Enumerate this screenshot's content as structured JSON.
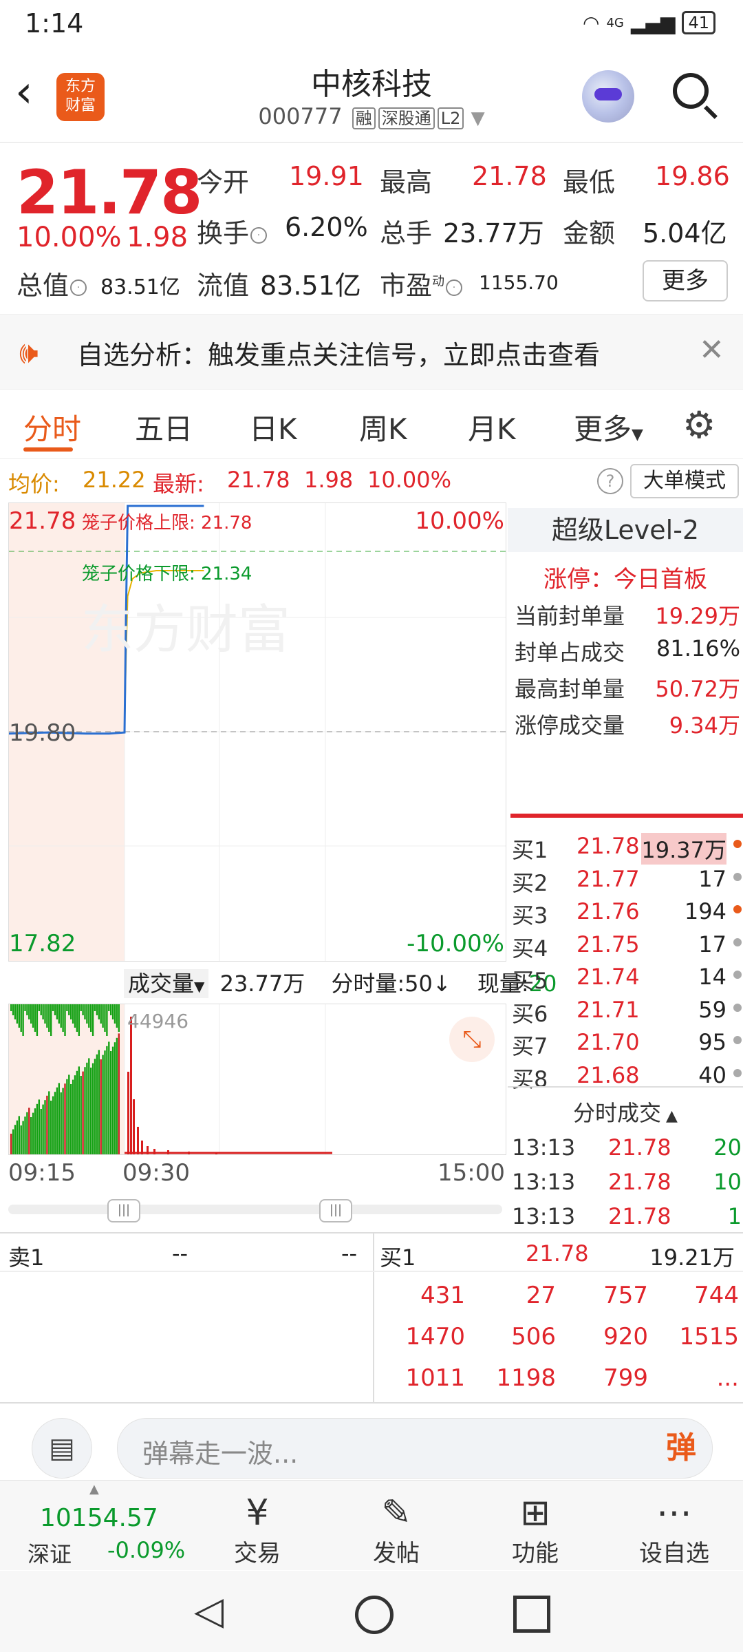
{
  "status_bar": {
    "time": "1:14",
    "network": "4G",
    "battery": "41"
  },
  "header": {
    "logo_text": [
      "东方",
      "财富"
    ],
    "stock_name": "中核科技",
    "stock_code": "000777",
    "tags": [
      "融",
      "深股通",
      "L2"
    ]
  },
  "quote": {
    "price": "21.78",
    "pct": "10.00%",
    "change": "1.98",
    "rows": [
      [
        {
          "label": "今开",
          "value": "19.91",
          "color": "red"
        },
        {
          "label": "最高",
          "value": "21.78",
          "color": "red"
        },
        {
          "label": "最低",
          "value": "19.86",
          "color": "red"
        }
      ],
      [
        {
          "label": "换手",
          "value": "6.20%",
          "color": "dark"
        },
        {
          "label": "总手",
          "value": "23.77万",
          "color": "dark"
        },
        {
          "label": "金额",
          "value": "5.04亿",
          "color": "dark"
        }
      ]
    ],
    "total_value_label": "总值",
    "total_value": "83.51亿",
    "float_value_label": "流值",
    "float_value": "83.51亿",
    "pe_label": "市盈",
    "pe_sup": "动",
    "pe_value": "1155.70",
    "more": "更多"
  },
  "banner": {
    "text": "自选分析：触发重点关注信号，立即点击查看"
  },
  "tabs": [
    "分时",
    "五日",
    "日K",
    "周K",
    "月K",
    "更多"
  ],
  "avgbar": {
    "avg_label": "均价:",
    "avg_value": "21.22",
    "latest_label": "最新:",
    "latest_value": "21.78",
    "latest_change": "1.98",
    "latest_pct": "10.00%",
    "mode": "大单模式"
  },
  "chart": {
    "y_max": "21.78",
    "y_mid": "19.80",
    "y_min": "17.82",
    "pct_max": "10.00%",
    "pct_min": "-10.00%",
    "upper_limit": "笼子价格上限: 21.78",
    "lower_limit": "笼子价格下限: 21.34",
    "watermark": "东方财富",
    "time_start": "09:15",
    "time_open": "09:30",
    "time_end": "15:00",
    "vol_peak": "44946",
    "vol_label": "成交量",
    "vol_total": "23.77万",
    "vol_unit": "分时量:50↓",
    "vol_now_label": "现量:",
    "vol_now": "20"
  },
  "chart_data": {
    "type": "line",
    "title": "",
    "ylim": [
      17.82,
      21.78
    ],
    "series": [
      {
        "x": [
          "09:15",
          "09:20",
          "09:25",
          "09:28",
          "09:30",
          "09:31",
          "09:32",
          "09:35",
          "09:40",
          "09:45",
          "09:50",
          "10:00",
          "10:10",
          "10:20"
        ],
        "values": [
          19.81,
          19.82,
          19.81,
          19.81,
          19.82,
          20.9,
          21.78,
          21.78,
          21.78,
          21.78,
          21.78,
          21.78,
          21.78,
          21.78
        ]
      },
      {
        "x": [
          "09:30",
          "09:31",
          "09:32",
          "09:35",
          "09:40",
          "09:45",
          "09:50",
          "10:00",
          "10:10",
          "10:20"
        ],
        "values": [
          19.82,
          20.5,
          21.0,
          21.15,
          21.2,
          21.21,
          21.22,
          21.22,
          21.22,
          21.22
        ]
      }
    ]
  },
  "level2": {
    "title": "超级Level-2",
    "status": "涨停：今日首板",
    "stats": [
      {
        "label": "当前封单量",
        "value": "19.29万"
      },
      {
        "label": "封单占成交",
        "value": "81.16%",
        "color": "dark"
      },
      {
        "label": "最高封单量",
        "value": "50.72万"
      },
      {
        "label": "涨停成交量",
        "value": "9.34万"
      }
    ],
    "bids": [
      {
        "label": "买1",
        "price": "21.78",
        "vol": "19.37万",
        "dot": "orange"
      },
      {
        "label": "买2",
        "price": "21.77",
        "vol": "17",
        "dot": "gray"
      },
      {
        "label": "买3",
        "price": "21.76",
        "vol": "194",
        "dot": "orange"
      },
      {
        "label": "买4",
        "price": "21.75",
        "vol": "17",
        "dot": "gray"
      },
      {
        "label": "买5",
        "price": "21.74",
        "vol": "14",
        "dot": "gray"
      },
      {
        "label": "买6",
        "price": "21.71",
        "vol": "59",
        "dot": "gray"
      },
      {
        "label": "买7",
        "price": "21.70",
        "vol": "95",
        "dot": "gray"
      },
      {
        "label": "买8",
        "price": "21.68",
        "vol": "40",
        "dot": "gray"
      }
    ],
    "ticks_title": "分时成交",
    "ticks": [
      {
        "time": "13:13",
        "price": "21.78",
        "vol": "20"
      },
      {
        "time": "13:13",
        "price": "21.78",
        "vol": "10"
      },
      {
        "time": "13:13",
        "price": "21.78",
        "vol": "1"
      }
    ]
  },
  "book": {
    "sell_label": "卖1",
    "sell_price": "--",
    "sell_vol": "--",
    "buy_label": "买1",
    "buy_price": "21.78",
    "buy_vol": "19.21万",
    "queue": [
      [
        "431",
        "27",
        "757",
        "744"
      ],
      [
        "1470",
        "506",
        "920",
        "1515"
      ],
      [
        "1011",
        "1198",
        "799",
        "..."
      ]
    ]
  },
  "comment": {
    "placeholder": "弹幕走一波...",
    "danmu": "弹"
  },
  "bottom_nav": {
    "index_value": "10154.57",
    "index_name": "深证",
    "index_change": "-0.09%",
    "items": [
      "交易",
      "发帖",
      "功能",
      "设自选"
    ]
  }
}
